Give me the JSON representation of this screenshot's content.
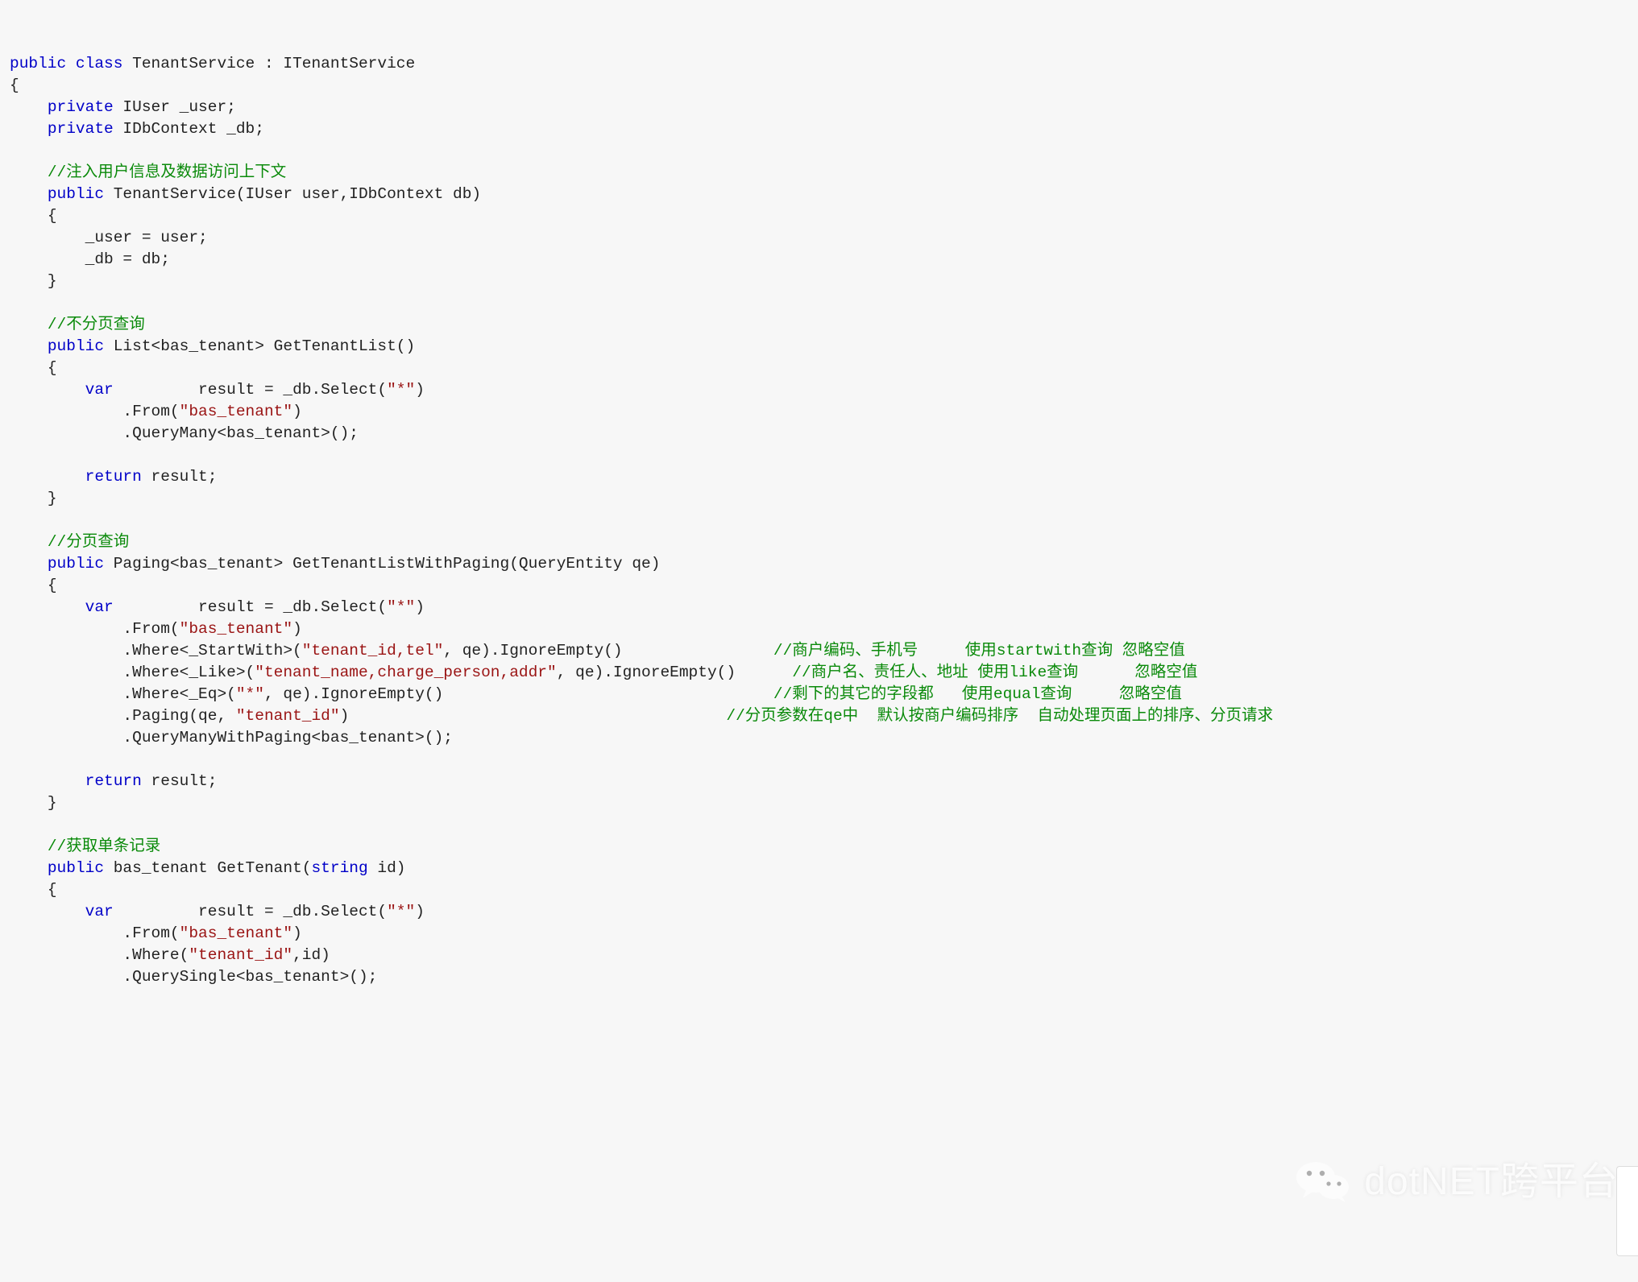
{
  "code": {
    "decl_public": "public",
    "decl_class": "class",
    "decl_private": "private",
    "decl_var": "var",
    "decl_return": "return",
    "decl_string": "string",
    "classname": " TenantService : ITenantService",
    "open_brace": "{",
    "close_brace": "}",
    "field_user": " IUser _user;",
    "field_db": " IDbContext _db;",
    "cmt_inject": "//注入用户信息及数据访问上下文",
    "ctor_sig": " TenantService(IUser user,IDbContext db)",
    "ctor_body1": "        _user = user;",
    "ctor_body2": "        _db = db;",
    "cmt_nopage": "//不分页查询",
    "m1_sig": " List<bas_tenant> GetTenantList()",
    "m1_l1a": "         result = _db.Select(",
    "m1_l1s": "\"*\"",
    "m1_l1b": ")",
    "m1_l2a": "            .From(",
    "m1_l2s": "\"bas_tenant\"",
    "m1_l2b": ")",
    "m1_l3": "            .QueryMany<bas_tenant>();",
    "ret_result": " result;",
    "cmt_page": "//分页查询",
    "m2_sig": " Paging<bas_tenant> GetTenantListWithPaging(QueryEntity qe)",
    "m2_l1a": "         result = _db.Select(",
    "m2_l1s": "\"*\"",
    "m2_l1b": ")",
    "m2_l2a": "            .From(",
    "m2_l2s": "\"bas_tenant\"",
    "m2_l2b": ")",
    "m2_l3a": "            .Where<_StartWith>(",
    "m2_l3s": "\"tenant_id,tel\"",
    "m2_l3b": ", qe).IgnoreEmpty()",
    "m2_l3c": "                //商户编码、手机号     使用startwith查询 忽略空值",
    "m2_l4a": "            .Where<_Like>(",
    "m2_l4s": "\"tenant_name,charge_person,addr\"",
    "m2_l4b": ", qe).IgnoreEmpty()",
    "m2_l4c": "      //商户名、责任人、地址 使用like查询      忽略空值",
    "m2_l5a": "            .Where<_Eq>(",
    "m2_l5s": "\"*\"",
    "m2_l5b": ", qe).IgnoreEmpty()",
    "m2_l5c": "                                   //剩下的其它的字段都   使用equal查询     忽略空值",
    "m2_l6a": "            .Paging(qe, ",
    "m2_l6s": "\"tenant_id\"",
    "m2_l6b": ")",
    "m2_l6c": "                                        //分页参数在qe中  默认按商户编码排序  自动处理页面上的排序、分页请求",
    "m2_l7": "            .QueryManyWithPaging<bas_tenant>();",
    "cmt_single": "//获取单条记录",
    "m3_sig_a": " bas_tenant GetTenant(",
    "m3_sig_b": " id)",
    "m3_l1a": "         result = _db.Select(",
    "m3_l1s": "\"*\"",
    "m3_l1b": ")",
    "m3_l2a": "            .From(",
    "m3_l2s": "\"bas_tenant\"",
    "m3_l2b": ")",
    "m3_l3a": "            .Where(",
    "m3_l3s": "\"tenant_id\"",
    "m3_l3b": ",id)",
    "m3_l4": "            .QuerySingle<bas_tenant>();"
  },
  "watermark": {
    "text": "dotNET跨平台"
  }
}
